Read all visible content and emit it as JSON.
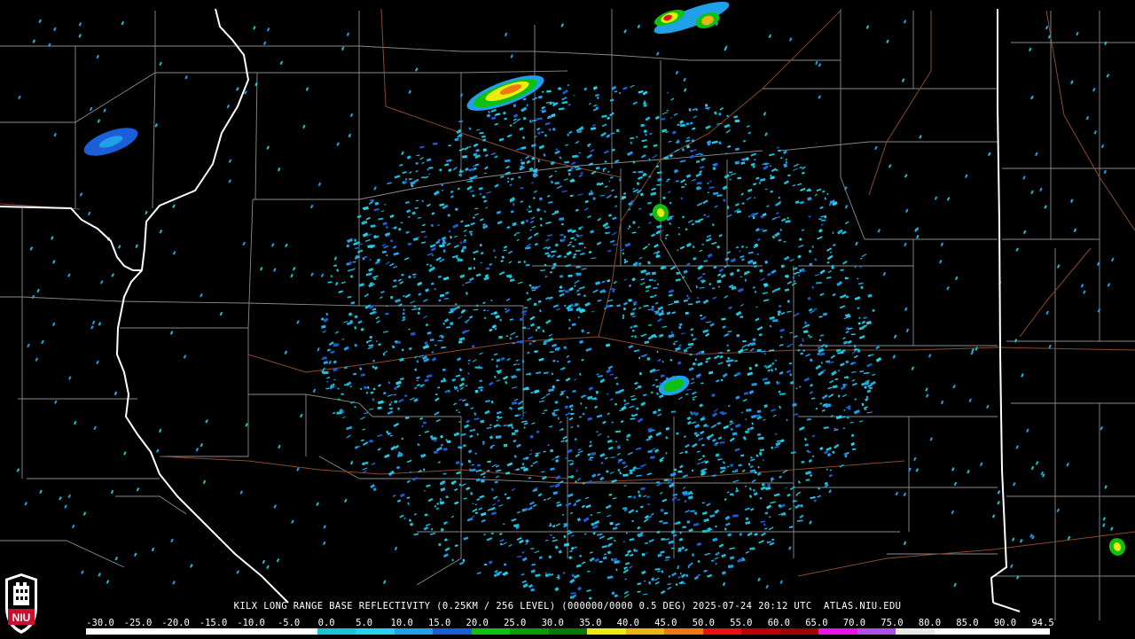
{
  "map": {
    "title": "KILX LONG RANGE BASE REFLECTIVITY (0.25KM / 256 LEVEL) (000000/0000 0.5 DEG) 2025-07-24 20:12 UTC  ATLAS.NIU.EDU",
    "background_color": "#000000",
    "county_line_color": "#8a8a8a",
    "state_line_color": "#ffffff",
    "road_color": "#8b4a2b"
  },
  "logo": {
    "text": "NIU",
    "color": "#c8102e"
  },
  "scale": {
    "labels": [
      "-30.0",
      "-25.0",
      "-20.0",
      "-15.0",
      "-10.0",
      "-5.0",
      "0.0",
      "5.0",
      "10.0",
      "15.0",
      "20.0",
      "25.0",
      "30.0",
      "35.0",
      "40.0",
      "45.0",
      "50.0",
      "55.0",
      "60.0",
      "65.0",
      "70.0",
      "75.0",
      "80.0",
      "85.0",
      "90.0",
      "94.5"
    ],
    "colors": [
      "#ffffff",
      "#ffffff",
      "#ffffff",
      "#ffffff",
      "#ffffff",
      "#ffffff",
      "#19c3d6",
      "#25d1ec",
      "#1fa0e8",
      "#1b5fd8",
      "#10c010",
      "#0a9a0a",
      "#067806",
      "#ecec10",
      "#ecb410",
      "#ec7a10",
      "#ec1010",
      "#c00000",
      "#a00000",
      "#ec10ec",
      "#b050e8",
      "#e8e8e8",
      "#ffffff",
      "#ffffff",
      "#ffffff"
    ]
  }
}
